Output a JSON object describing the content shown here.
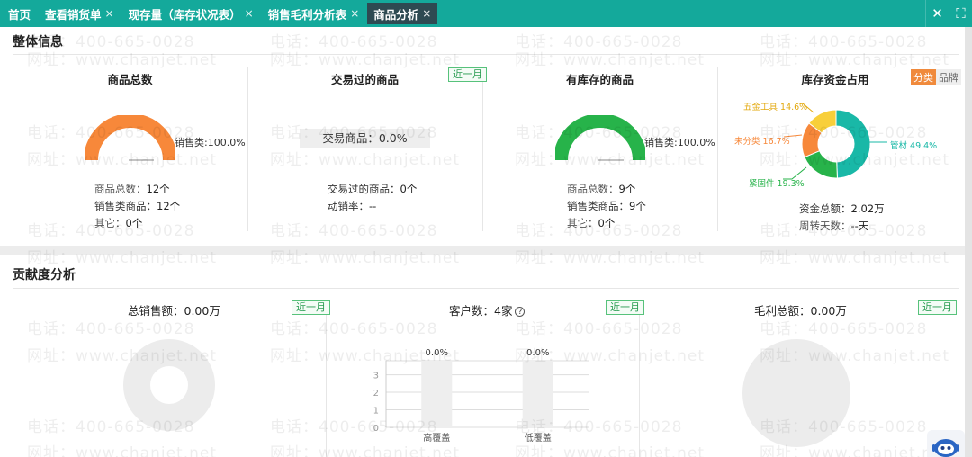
{
  "tabs": [
    {
      "label": "首页",
      "closable": false,
      "active": false
    },
    {
      "label": "查看销货单",
      "closable": true,
      "active": false
    },
    {
      "label": "现存量（库存状况表）",
      "closable": true,
      "active": false
    },
    {
      "label": "销售毛利分析表",
      "closable": true,
      "active": false
    },
    {
      "label": "商品分析",
      "closable": true,
      "active": true
    }
  ],
  "tab_close_glyph": "×",
  "window_controls": {
    "close": "✕",
    "fullscreen": "⛶"
  },
  "overview": {
    "title": "整体信息",
    "total": {
      "title": "商品总数",
      "gauge_label": "销售类:100.0%",
      "gauge_value": 100,
      "gauge_color": "#f7883a",
      "stats": [
        {
          "k": "商品总数：",
          "v": "12个"
        },
        {
          "k": "销售类商品：",
          "v": "12个"
        },
        {
          "k": "其它：",
          "v": "0个"
        }
      ]
    },
    "traded": {
      "title": "交易过的商品",
      "badge": "近一月",
      "box_text": "交易商品：0.0%",
      "stats": [
        {
          "k": "交易过的商品：",
          "v": "0个"
        },
        {
          "k": "动销率：",
          "v": "--"
        }
      ]
    },
    "instock": {
      "title": "有库存的商品",
      "gauge_label": "销售类:100.0%",
      "gauge_value": 100,
      "gauge_color": "#27b34a",
      "stats": [
        {
          "k": "商品总数：",
          "v": "9个"
        },
        {
          "k": "销售类商品：",
          "v": "9个"
        },
        {
          "k": "其它：",
          "v": "0个"
        }
      ]
    },
    "capital": {
      "title": "库存资金占用",
      "toggle_on": "分类",
      "toggle_off": "品牌",
      "stats": [
        {
          "k": "资金总额：",
          "v": "2.02万"
        },
        {
          "k": "周转天数：",
          "v": "--天"
        }
      ]
    }
  },
  "contribution": {
    "title": "贡献度分析",
    "sales": {
      "label": "总销售额：0.00万",
      "badge": "近一月"
    },
    "customers": {
      "label": "客户数：4家",
      "help": "?",
      "badge": "近一月"
    },
    "profit": {
      "label": "毛利总额：0.00万",
      "badge": "近一月"
    }
  },
  "watermark": {
    "phone": "电话：400-665-0028",
    "site": "网址：www.chanjet.net"
  },
  "chart_data": [
    {
      "type": "pie",
      "title": "",
      "categories": [
        "管材",
        "紧固件",
        "未分类",
        "五金工具"
      ],
      "labels": [
        "管材 49.4%",
        "紧固件 19.3%",
        "未分类 16.7%",
        "五金工具 14.6%"
      ],
      "values": [
        49.4,
        19.3,
        16.7,
        14.6
      ],
      "colors": [
        "#19b8a7",
        "#27b34a",
        "#f7883a",
        "#f8cf3a"
      ],
      "donut": true
    },
    {
      "type": "bar",
      "title": "",
      "categories": [
        "高覆盖",
        "低覆盖"
      ],
      "values": [
        0,
        0
      ],
      "data_labels": [
        "0.0%",
        "0.0%"
      ],
      "yticks": [
        "0",
        "1",
        "2",
        "3"
      ],
      "ylim": [
        0,
        3.8
      ],
      "xlabel": "",
      "ylabel": "",
      "grid": true
    }
  ]
}
